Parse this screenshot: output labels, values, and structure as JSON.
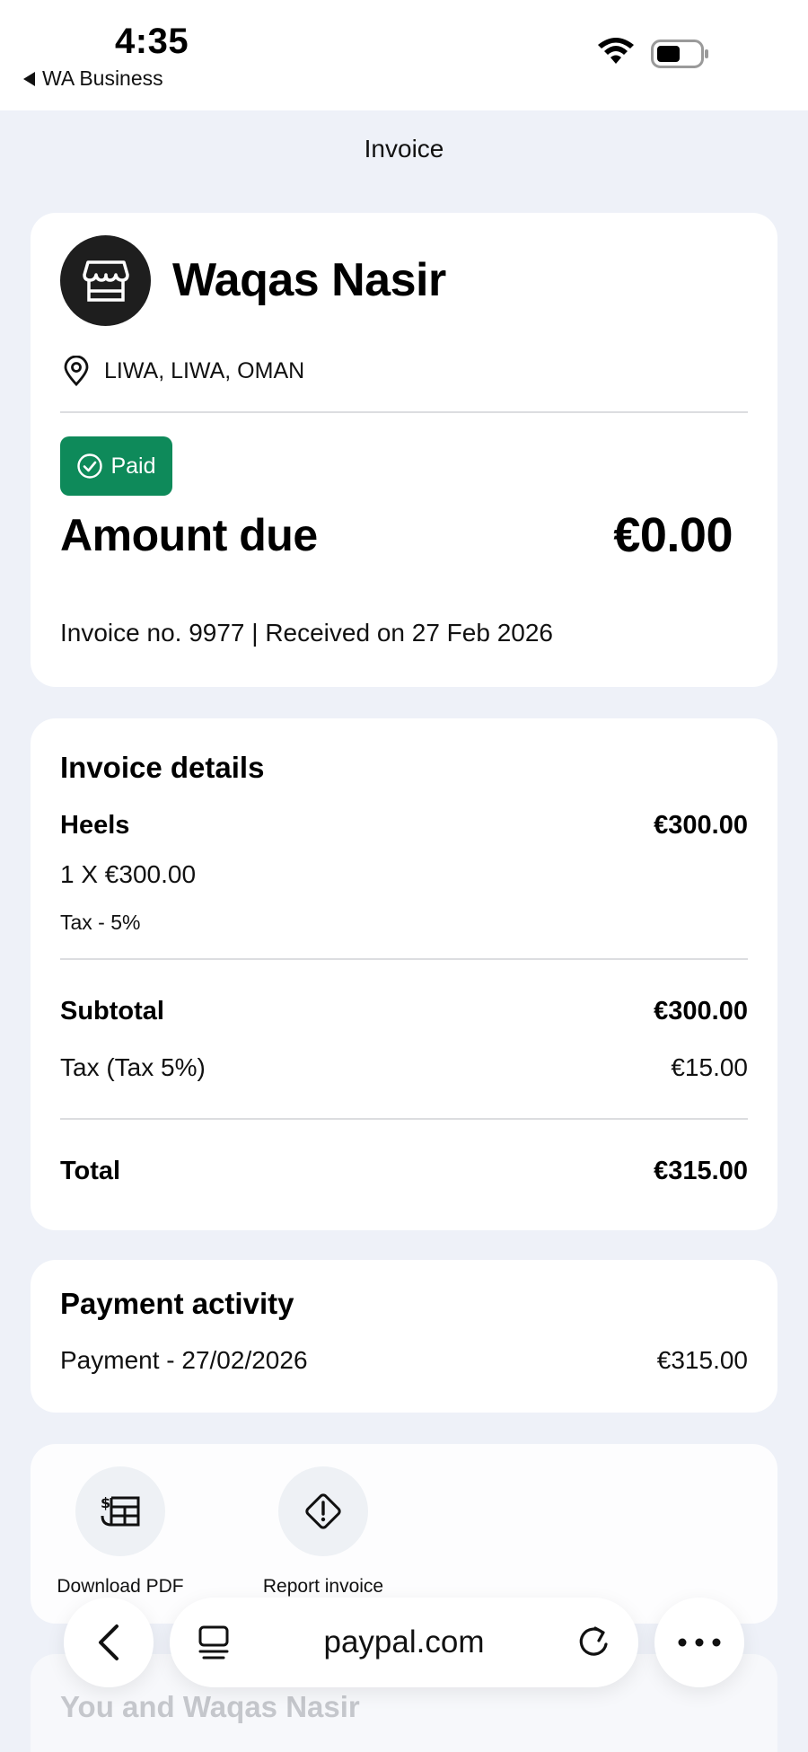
{
  "status_bar": {
    "time": "4:35",
    "back_app": "WA Business"
  },
  "page": {
    "title": "Invoice"
  },
  "merchant": {
    "name": "Waqas Nasir",
    "location": "LIWA, LIWA, OMAN",
    "status_badge": "Paid",
    "amount_label": "Amount due",
    "amount_value": "€0.00",
    "invoice_meta": "Invoice no. 9977 | Received on 27 Feb 2026"
  },
  "details": {
    "title": "Invoice details",
    "item_name": "Heels",
    "item_amount": "€300.00",
    "item_quantity": "1 X €300.00",
    "item_tax": "Tax - 5%",
    "subtotal_label": "Subtotal",
    "subtotal_value": "€300.00",
    "tax_label": "Tax (Tax 5%)",
    "tax_value": "€15.00",
    "total_label": "Total",
    "total_value": "€315.00"
  },
  "activity": {
    "title": "Payment activity",
    "payment_label": "Payment - 27/02/2026",
    "payment_value": "€315.00"
  },
  "actions": {
    "download_label": "Download PDF",
    "report_label": "Report invoice"
  },
  "faded_section": {
    "title": "You and Waqas Nasir"
  },
  "browser": {
    "url": "paypal.com"
  },
  "colors": {
    "background": "#eef1f8",
    "paid_badge": "#0e8a5a",
    "avatar": "#1e1e1e"
  }
}
